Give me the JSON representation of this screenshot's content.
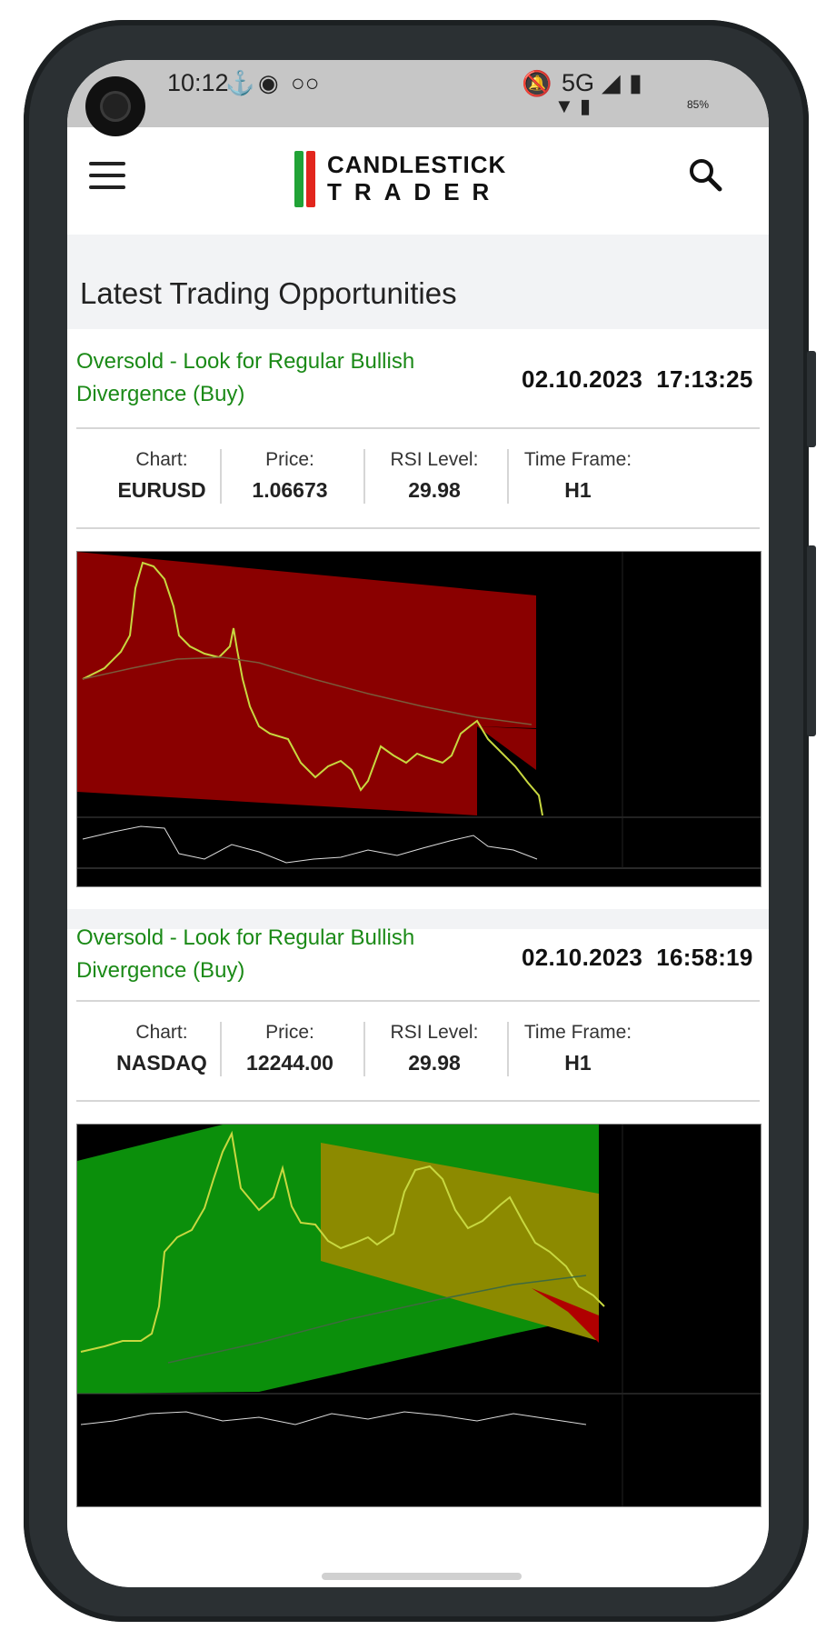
{
  "status": {
    "time": "10:12",
    "network": "5G",
    "battery": "85%"
  },
  "app": {
    "logo_line1": "CANDLESTICK",
    "logo_line2": "TRADER"
  },
  "page": {
    "heading": "Latest Trading Opportunities"
  },
  "cards": [
    {
      "signal": "Oversold - Look for Regular Bullish Divergence (Buy)",
      "date": "02.10.2023",
      "time": "17:13:25",
      "stats": [
        {
          "label": "Chart:",
          "value": "EURUSD"
        },
        {
          "label": "Price:",
          "value": "1.06673"
        },
        {
          "label": "RSI Level:",
          "value": "29.98"
        },
        {
          "label": "Time Frame:",
          "value": "H1"
        }
      ],
      "theme": {
        "zone": "#8a0000",
        "bg": "#000000"
      }
    },
    {
      "signal": "Oversold - Look for Regular Bullish Divergence (Buy)",
      "date": "02.10.2023",
      "time": "16:58:19",
      "stats": [
        {
          "label": "Chart:",
          "value": "NASDAQ"
        },
        {
          "label": "Price:",
          "value": "12244.00"
        },
        {
          "label": "RSI Level:",
          "value": "29.98"
        },
        {
          "label": "Time Frame:",
          "value": "H1"
        }
      ],
      "theme": {
        "zone": "#0b8f0b",
        "bg": "#000000"
      }
    }
  ],
  "colors": {
    "signal": "#1b8a17",
    "frame": "#2b3033"
  }
}
